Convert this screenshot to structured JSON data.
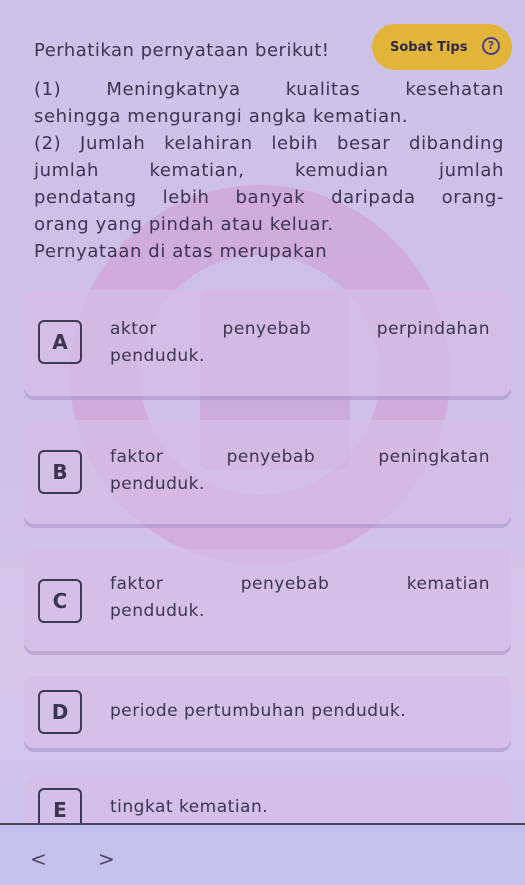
{
  "intro": "Perhatikan pernyataan berikut!",
  "sobat_tips": "Sobat Tips",
  "question_lines": [
    "(1)  Meningkatnya  kualitas  kesehatan",
    "sehingga mengurangi angka kematian.",
    "(2) Jumlah kelahiran lebih besar dibanding",
    "jumlah  kematian,  kemudian  jumlah",
    "pendatang lebih banyak daripada orang-",
    "orang yang pindah atau keluar.",
    "Pernyataan di atas merupakan"
  ],
  "options": [
    {
      "letter": "A",
      "line1": [
        "aktor",
        "penyebab",
        "perpindahan"
      ],
      "line2": "penduduk."
    },
    {
      "letter": "B",
      "line1": [
        "faktor",
        "penyebab",
        "peningkatan"
      ],
      "line2": "penduduk."
    },
    {
      "letter": "C",
      "line1": [
        "faktor",
        "penyebab",
        "kematian"
      ],
      "line2": "penduduk."
    },
    {
      "letter": "D",
      "text": "periode pertumbuhan penduduk."
    },
    {
      "letter": "E",
      "text": "tingkat kematian."
    }
  ],
  "nav": {
    "prev": "<",
    "next": ">"
  }
}
